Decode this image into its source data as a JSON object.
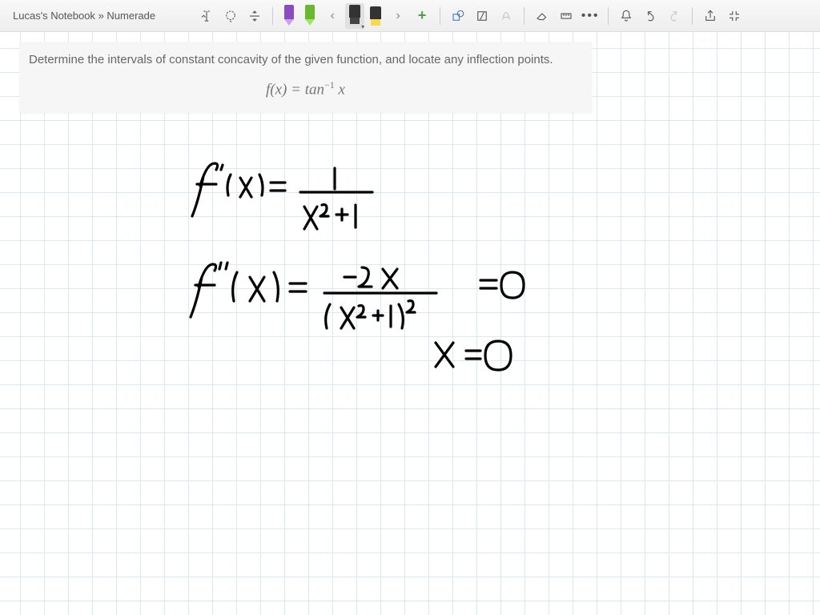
{
  "header": {
    "notebook_name": "Lucas's Notebook",
    "separator": "»",
    "page_name": "Numerade"
  },
  "problem": {
    "prompt": "Determine the intervals of constant concavity of the given function, and locate any inflection points.",
    "formula_lhs": "f(x)",
    "formula_eq": " = ",
    "formula_rhs_base": "tan",
    "formula_rhs_exp": "−1",
    "formula_rhs_var": " x"
  },
  "handwritten": {
    "line1": "f'(x) = 1 / (x² + 1)",
    "line2": "f''(x) = -2x / (x² + 1)²  = 0",
    "line3": "x = 0"
  },
  "colors": {
    "pen_purple": "#8a4dbf",
    "pen_green": "#6ab82e",
    "hl_black": "#222",
    "hl_yellow": "#f7d94c"
  }
}
